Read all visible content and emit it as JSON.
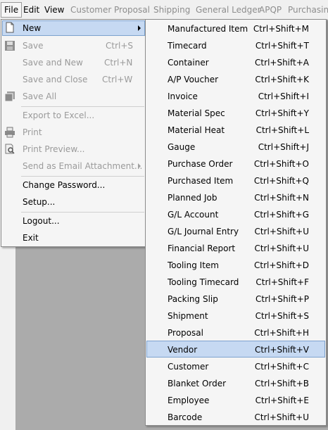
{
  "menubar": {
    "items": [
      {
        "label": "File"
      },
      {
        "label": "Edit"
      },
      {
        "label": "View"
      },
      {
        "label": "Customer"
      },
      {
        "label": "Proposal"
      },
      {
        "label": "Shipping"
      },
      {
        "label": "General Ledger"
      },
      {
        "label": "APQP"
      },
      {
        "label": "Purchasing"
      }
    ]
  },
  "file_menu": {
    "new": {
      "label": "New",
      "icon": "new-document-icon"
    },
    "save": {
      "label": "Save",
      "shortcut": "Ctrl+S",
      "icon": "save-icon"
    },
    "save_new": {
      "label": "Save and New",
      "shortcut": "Ctrl+N"
    },
    "save_close": {
      "label": "Save and Close",
      "shortcut": "Ctrl+W"
    },
    "save_all": {
      "label": "Save All",
      "icon": "save-all-icon"
    },
    "export_excel": {
      "label": "Export to Excel..."
    },
    "print": {
      "label": "Print",
      "icon": "printer-icon"
    },
    "print_preview": {
      "label": "Print Preview...",
      "icon": "print-preview-icon"
    },
    "send_email": {
      "label": "Send as Email Attachment..."
    },
    "change_password": {
      "label": "Change Password..."
    },
    "setup": {
      "label": "Setup..."
    },
    "logout": {
      "label": "Logout..."
    },
    "exit": {
      "label": "Exit"
    }
  },
  "new_submenu": {
    "items": [
      {
        "label": "Manufactured Item",
        "shortcut": "Ctrl+Shift+M"
      },
      {
        "label": "Timecard",
        "shortcut": "Ctrl+Shift+T"
      },
      {
        "label": "Container",
        "shortcut": "Ctrl+Shift+A"
      },
      {
        "label": "A/P Voucher",
        "shortcut": "Ctrl+Shift+K"
      },
      {
        "label": "Invoice",
        "shortcut": "Ctrl+Shift+I"
      },
      {
        "label": "Material Spec",
        "shortcut": "Ctrl+Shift+Y"
      },
      {
        "label": "Material Heat",
        "shortcut": "Ctrl+Shift+L"
      },
      {
        "label": "Gauge",
        "shortcut": "Ctrl+Shift+J"
      },
      {
        "label": "Purchase Order",
        "shortcut": "Ctrl+Shift+O"
      },
      {
        "label": "Purchased Item",
        "shortcut": "Ctrl+Shift+Q"
      },
      {
        "label": "Planned Job",
        "shortcut": "Ctrl+Shift+N"
      },
      {
        "label": "G/L Account",
        "shortcut": "Ctrl+Shift+G"
      },
      {
        "label": "G/L Journal Entry",
        "shortcut": "Ctrl+Shift+U"
      },
      {
        "label": "Financial Report",
        "shortcut": "Ctrl+Shift+U"
      },
      {
        "label": "Tooling Item",
        "shortcut": "Ctrl+Shift+D"
      },
      {
        "label": "Tooling Timecard",
        "shortcut": "Ctrl+Shift+F"
      },
      {
        "label": "Packing Slip",
        "shortcut": "Ctrl+Shift+P"
      },
      {
        "label": "Shipment",
        "shortcut": "Ctrl+Shift+S"
      },
      {
        "label": "Proposal",
        "shortcut": "Ctrl+Shift+H"
      },
      {
        "label": "Vendor",
        "shortcut": "Ctrl+Shift+V"
      },
      {
        "label": "Customer",
        "shortcut": "Ctrl+Shift+C"
      },
      {
        "label": "Blanket Order",
        "shortcut": "Ctrl+Shift+B"
      },
      {
        "label": "Employee",
        "shortcut": "Ctrl+Shift+E"
      },
      {
        "label": "Barcode",
        "shortcut": "Ctrl+Shift+U"
      }
    ]
  },
  "colors": {
    "highlight": "#c6d9f2",
    "highlight_border": "#7da2ce",
    "disabled_text": "#9a9a9a",
    "workspace": "#ababab"
  }
}
